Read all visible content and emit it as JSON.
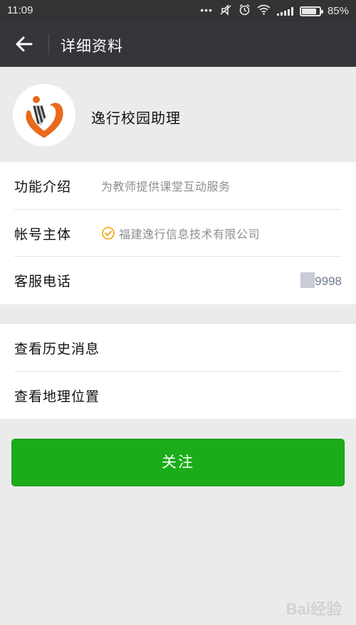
{
  "status_bar": {
    "time": "11:09",
    "battery_text": "85%",
    "battery_level": 0.85,
    "icons": [
      "more-dots-icon",
      "mute-icon",
      "alarm-icon",
      "wifi-icon",
      "signal-icon",
      "battery-icon"
    ]
  },
  "header": {
    "title": "详细资料",
    "back_icon": "arrow-left-icon"
  },
  "profile": {
    "name": "逸行校园助理",
    "avatar_icon": "logo-avatar"
  },
  "info": {
    "intro_label": "功能介绍",
    "intro_value": "为教师提供课堂互动服务",
    "owner_label": "帐号主体",
    "owner_value": "福建逸行信息技术有限公司",
    "phone_label": "客服电话",
    "phone_value": "9998"
  },
  "links": {
    "history_label": "查看历史消息",
    "location_label": "查看地理位置"
  },
  "actions": {
    "follow_label": "关注"
  },
  "watermark": {
    "text": "Bai经验"
  },
  "colors": {
    "status_bar_bg": "#333336",
    "title_bar_bg": "#35353a",
    "page_bg": "#ebebeb",
    "follow_button": "#1aad19",
    "verified": "#f0a300",
    "avatar_orange": "#e86a1c"
  }
}
